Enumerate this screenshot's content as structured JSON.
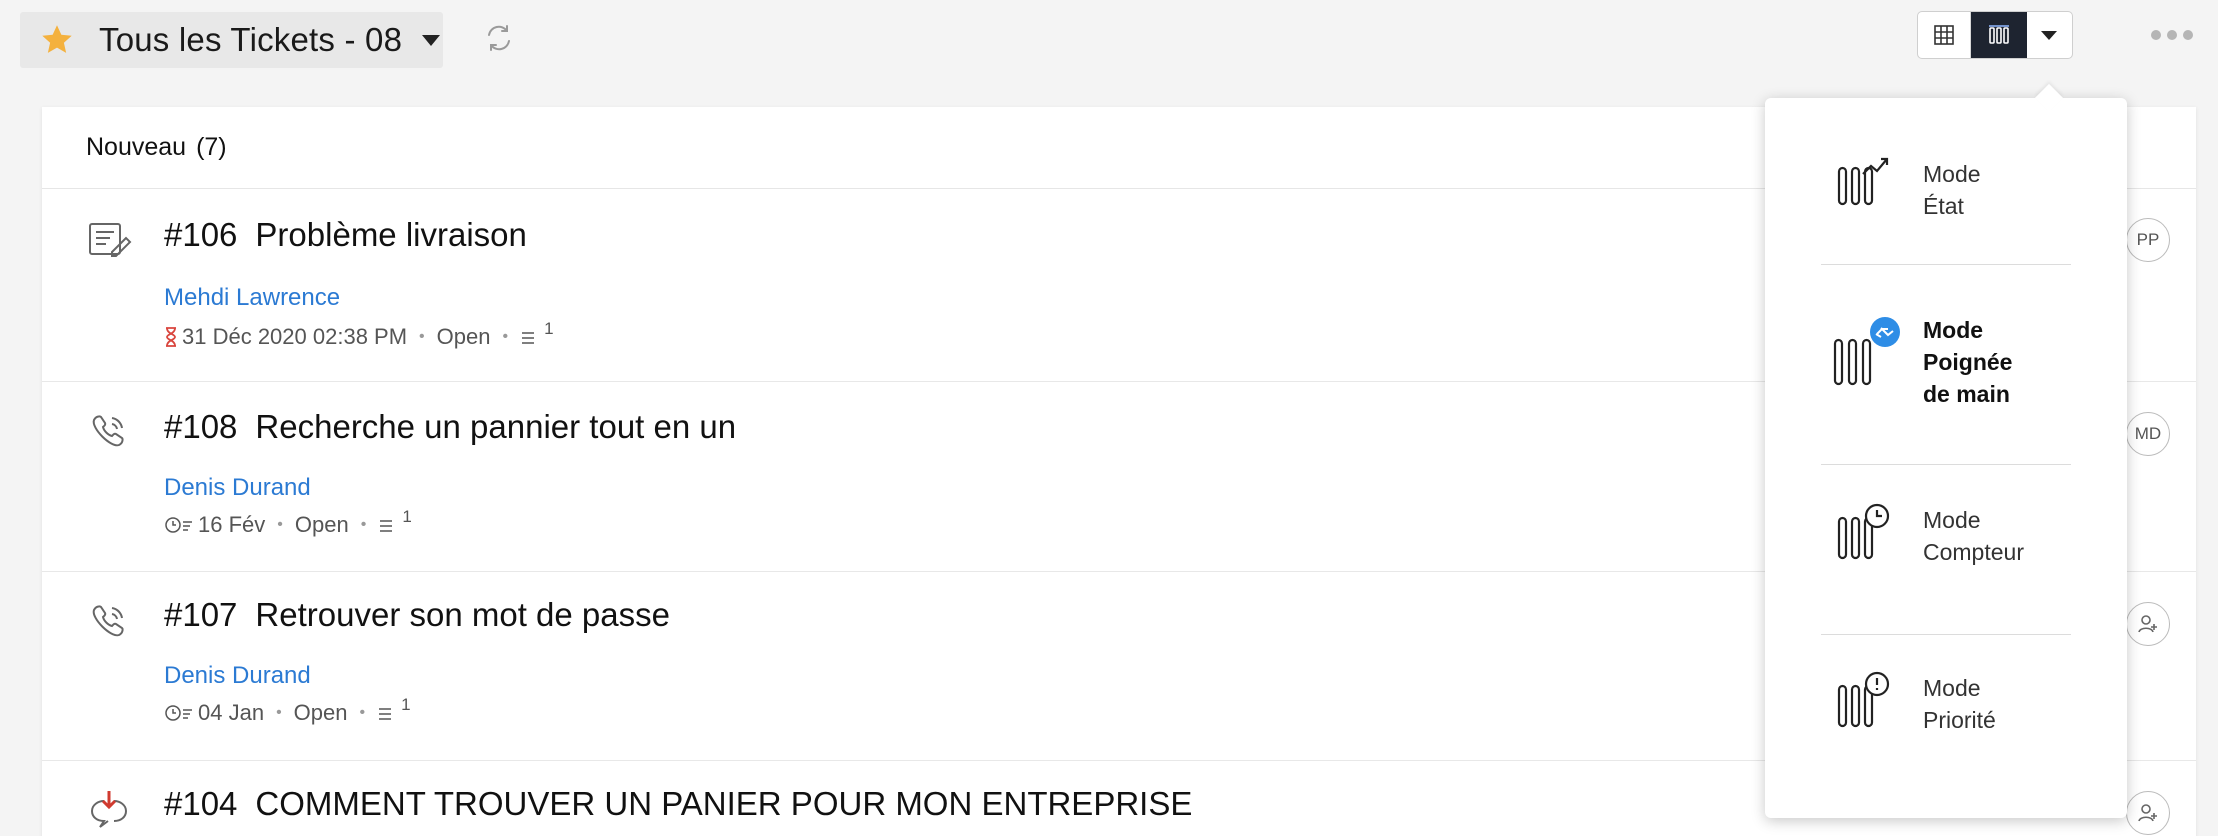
{
  "header": {
    "title": "Tous les Tickets - 08",
    "star_color": "#f4b13e"
  },
  "view_switch": {
    "items": [
      "table-view-icon",
      "kanban-view-icon",
      "caret-down-icon"
    ],
    "active": "kanban-view-icon"
  },
  "section": {
    "label": "Nouveau",
    "count": "(7)"
  },
  "tickets": [
    {
      "number": "#106",
      "subject": "Problème livraison",
      "contact": "Mehdi Lawrence",
      "due_icon": "hourglass-icon",
      "due": "31 Déc 2020 02:38 PM",
      "status": "Open",
      "threads": "1",
      "channel_icon": "web-form-icon",
      "avatar": "PP"
    },
    {
      "number": "#108",
      "subject": "Recherche un pannier tout en un",
      "contact": "Denis Durand",
      "due_icon": "clock-icon",
      "due": "16 Fév",
      "status": "Open",
      "threads": "1",
      "channel_icon": "phone-icon",
      "avatar": "MD"
    },
    {
      "number": "#107",
      "subject": "Retrouver son mot de passe",
      "contact": "Denis Durand",
      "due_icon": "clock-icon",
      "due": "04 Jan",
      "status": "Open",
      "threads": "1",
      "channel_icon": "phone-icon",
      "avatar": ""
    },
    {
      "number": "#104",
      "subject": "COMMENT TROUVER UN PANIER POUR MON ENTREPRISE",
      "channel_icon": "escalated-chat-icon",
      "avatar": ""
    }
  ],
  "modes": [
    {
      "line1": "Mode",
      "line2": "État",
      "line3": "",
      "icon": "mode-status-icon",
      "active": false
    },
    {
      "line1": "Mode",
      "line2": "Poignée",
      "line3": "de main",
      "icon": "mode-handshake-icon",
      "active": true
    },
    {
      "line1": "Mode",
      "line2": "Compteur",
      "line3": "",
      "icon": "mode-timer-icon",
      "active": false
    },
    {
      "line1": "Mode",
      "line2": "Priorité",
      "line3": "",
      "icon": "mode-priority-icon",
      "active": false
    }
  ]
}
